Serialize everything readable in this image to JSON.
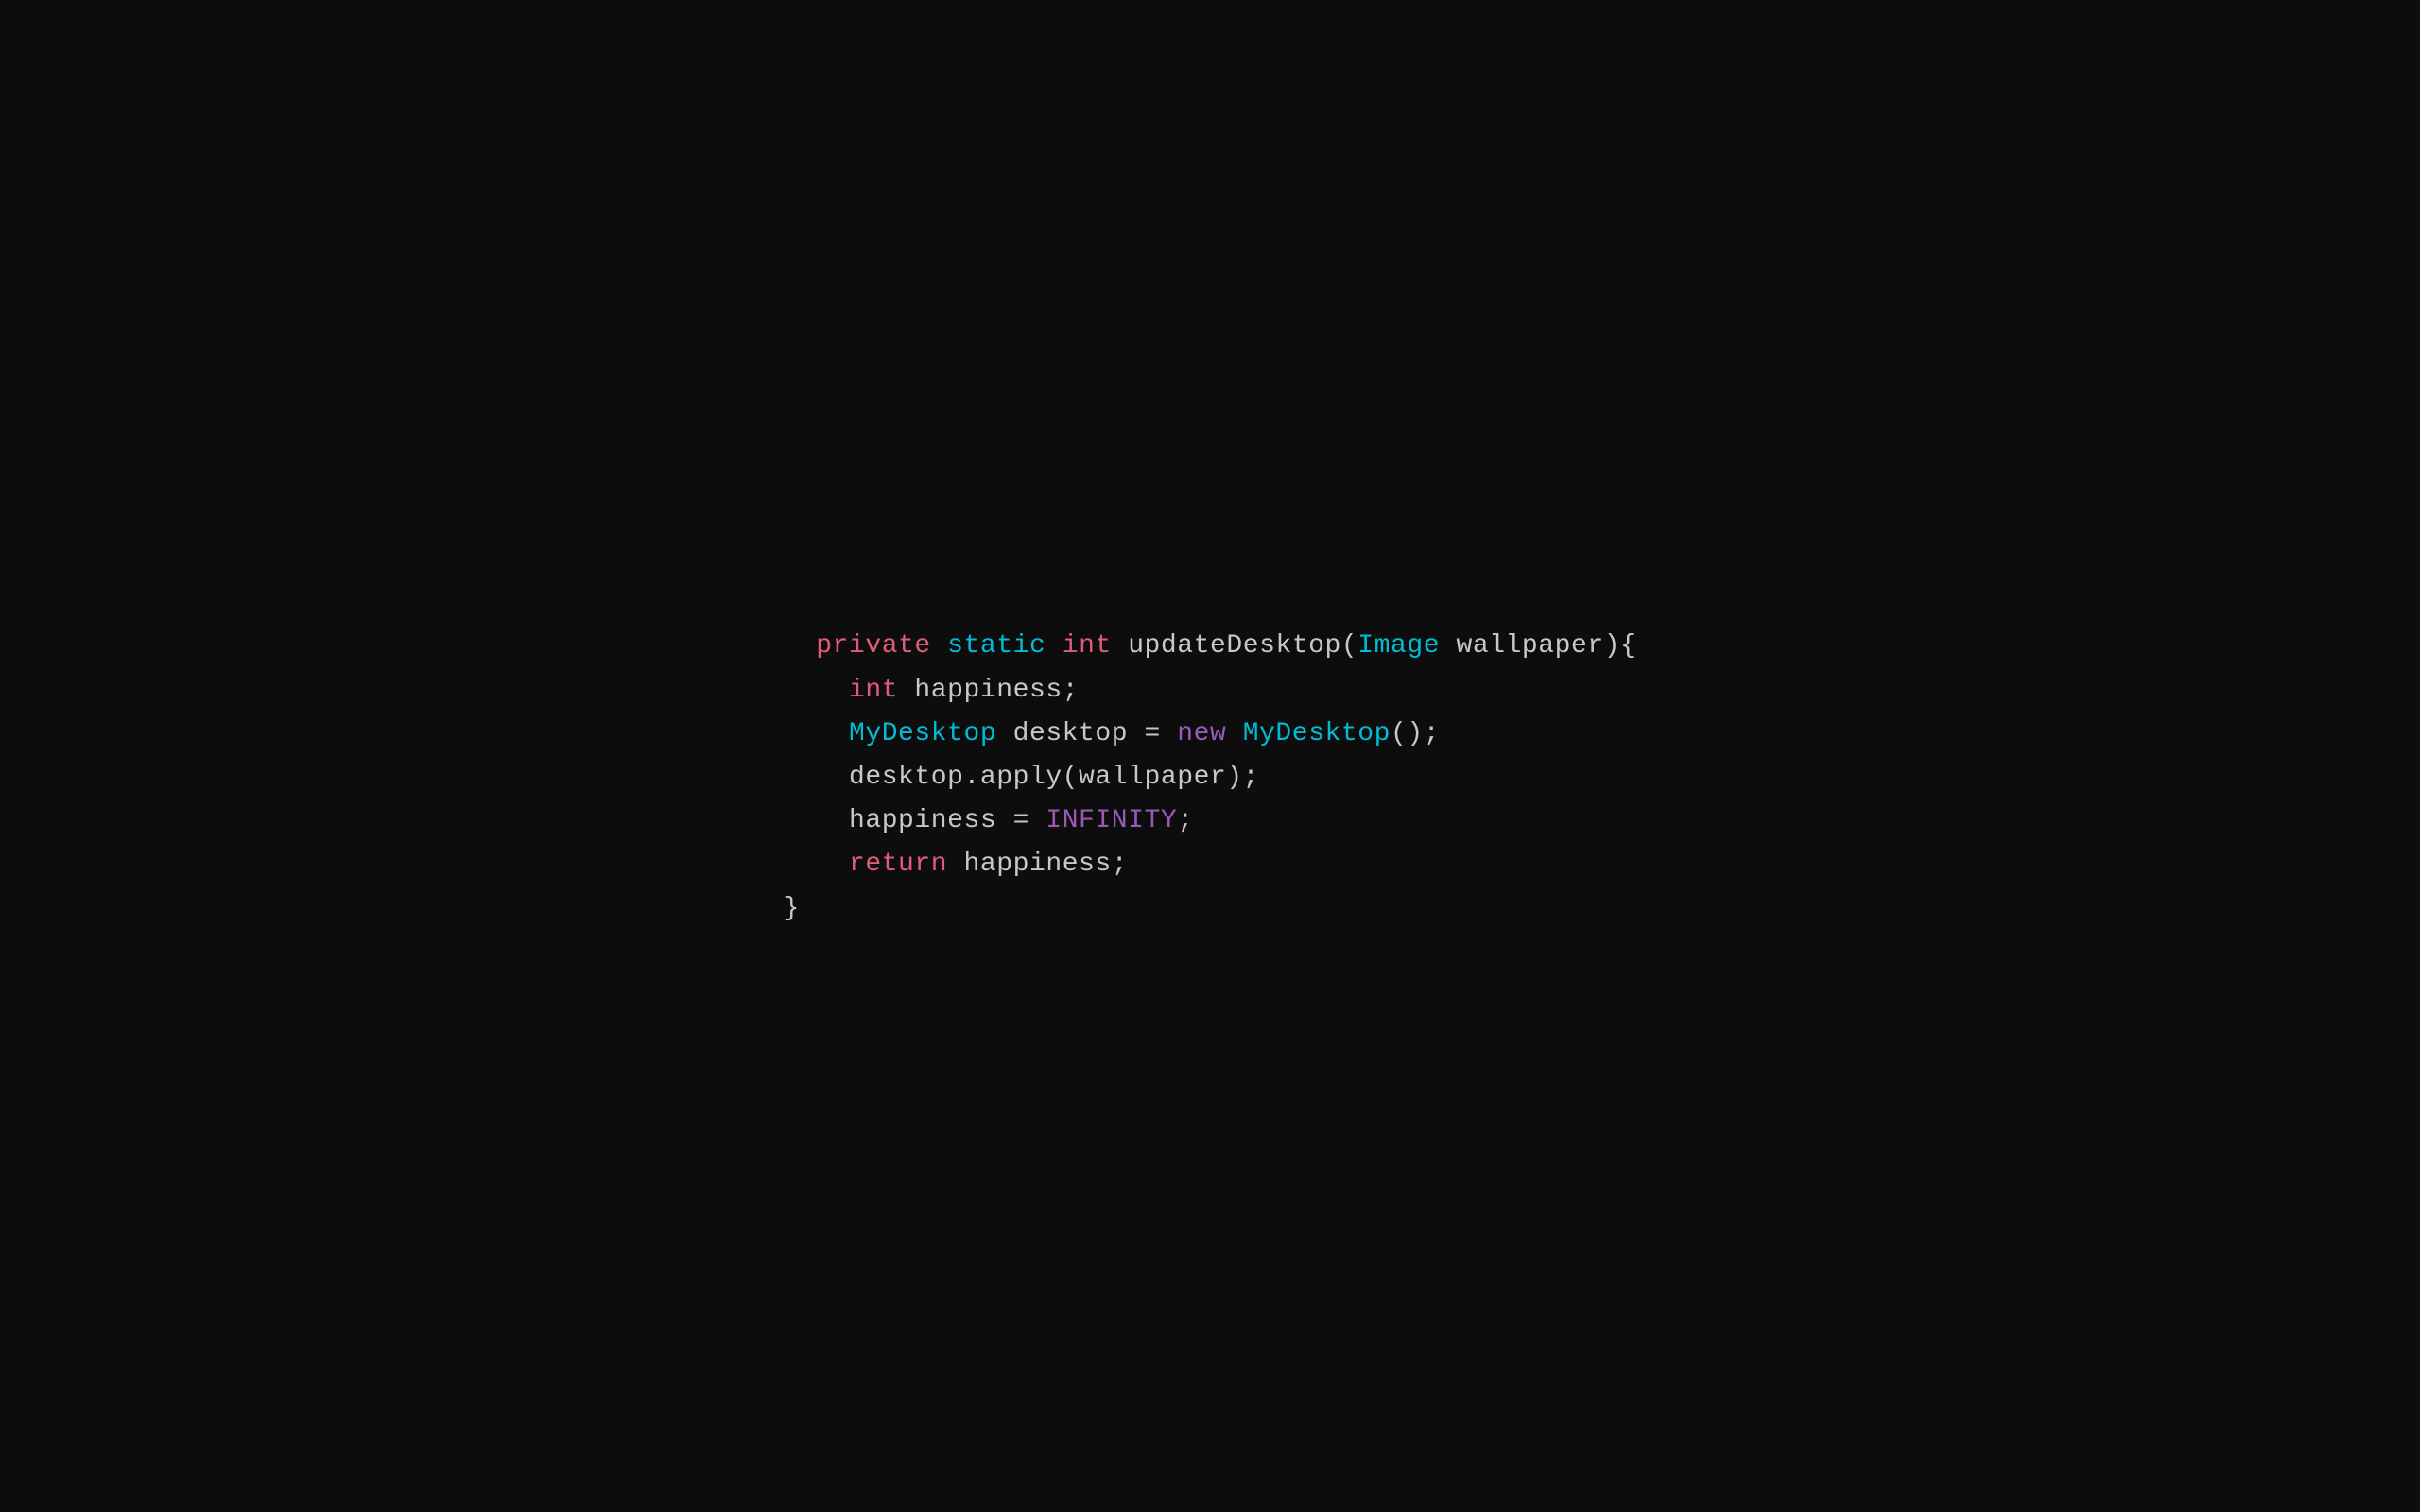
{
  "code": {
    "line1": {
      "kw_private": "private",
      "kw_static": "static",
      "kw_int": "int",
      "method": " updateDesktop(",
      "kw_image": "Image",
      "param": " wallpaper){"
    },
    "line2": {
      "kw_int": "int",
      "rest": " happiness;"
    },
    "line3": {
      "kw_mydesktop": "MyDesktop",
      "rest1": " desktop = ",
      "kw_new": "new",
      "rest2": " ",
      "kw_mydesktop2": "MyDesktop",
      "rest3": "();"
    },
    "line4": {
      "text": "desktop.apply(wallpaper);"
    },
    "line5": {
      "text1": "happiness = ",
      "kw_infinity": "INFINITY",
      "text2": ";"
    },
    "line6": {
      "kw_return": "return",
      "text": " happiness;"
    },
    "line7": {
      "text": "}"
    }
  }
}
